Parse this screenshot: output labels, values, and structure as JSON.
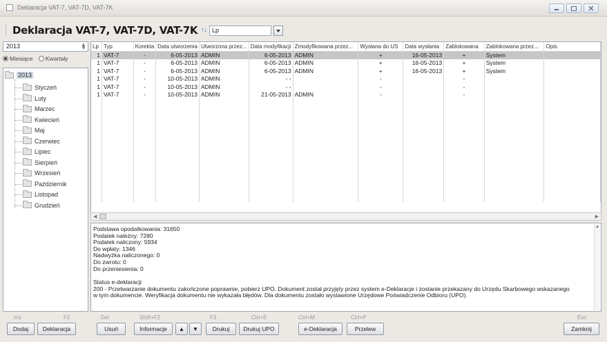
{
  "window": {
    "title": "Deklaracja VAT-7, VAT-7D, VAT-7K",
    "page_title": "Deklaracja VAT-7, VAT-7D, VAT-7K",
    "sort_field": "Lp"
  },
  "filter": {
    "year": "2013",
    "period_options": [
      "Miesiące",
      "Kwartały"
    ],
    "period_selected": "Miesiące"
  },
  "tree": {
    "root": "2013",
    "months": [
      "Styczeń",
      "Luty",
      "Marzec",
      "Kwiecień",
      "Maj",
      "Czerwiec",
      "Lipiec",
      "Sierpień",
      "Wrzesień",
      "Październik",
      "Listopad",
      "Grudzień"
    ]
  },
  "table": {
    "columns": [
      "Lp",
      "Typ",
      "Korekta",
      "Data utworzenia",
      "Utworzona przez...",
      "Data modyfikacji",
      "Zmodyfikowana przez...",
      "Wysłana do US",
      "Data wysłania",
      "Zablokowana",
      "Zablokowana przez...",
      "Opis"
    ],
    "rows": [
      [
        "1",
        "VAT-7",
        "-",
        "6-05-2013",
        "ADMIN",
        "6-05-2013",
        "ADMIN",
        "+",
        "16-05-2013",
        "+",
        "System",
        ""
      ],
      [
        "1",
        "VAT-7",
        "-",
        "6-05-2013",
        "ADMIN",
        "6-05-2013",
        "ADMIN",
        "+",
        "16-05-2013",
        "+",
        "System",
        ""
      ],
      [
        "1",
        "VAT-7",
        "-",
        "6-05-2013",
        "ADMIN",
        "6-05-2013",
        "ADMIN",
        "+",
        "16-05-2013",
        "+",
        "System",
        ""
      ],
      [
        "1",
        "VAT-7",
        "-",
        "10-05-2013",
        "ADMIN",
        "- -",
        "",
        "-",
        "",
        "-",
        "",
        ""
      ],
      [
        "1",
        "VAT-7",
        "-",
        "10-05-2013",
        "ADMIN",
        "- -",
        "",
        "-",
        "",
        "-",
        "",
        ""
      ],
      [
        "1",
        "VAT-7",
        "-",
        "10-05-2013",
        "ADMIN",
        "21-05-2013",
        "ADMIN",
        "-",
        "",
        "-",
        "",
        ""
      ]
    ]
  },
  "details": {
    "lines": [
      "Podstawa opodatkowania: 31650",
      "Podatek należny: 7280",
      "Podatek naliczony: 5934",
      "Do wpłaty: 1346",
      "Nadwyżka naliczonego: 0",
      "Do zwrotu: 0",
      "Do przeniesienia: 0"
    ],
    "status_title": "Status e-deklaracji",
    "status_lines": [
      "200 - Przetwarzanie dokumentu zakończone poprawnie, pobierz UPO. Dokument został przyjęty przez system e-Deklaracje i zostanie przekazany do Urzędu Skarbowego wskazanego",
      "w tym dokumencie. Weryfikacja dokumentu nie wykazała błędów. Dla dokumentu zostało wystawione Urzędowe Poświadczenie Odbioru (UPO)."
    ]
  },
  "buttons": {
    "add": {
      "label": "Dodaj",
      "key": "Ins"
    },
    "declaration": {
      "label": "Deklaracja",
      "key": "F2"
    },
    "delete": {
      "label": "Usuń",
      "key": "Del"
    },
    "info": {
      "label": "Informacje",
      "key": "Shift+F2"
    },
    "print": {
      "label": "Drukuj",
      "key": "F3"
    },
    "print_upo": {
      "label": "Drukuj UPO",
      "key": "Ctrl+E"
    },
    "edeclaration": {
      "label": "e-Deklaracja",
      "key": "Ctrl+M"
    },
    "recalc": {
      "label": "Przelew",
      "key": "Ctrl+P"
    },
    "close": {
      "label": "Zamknij",
      "key": "Esc"
    }
  }
}
